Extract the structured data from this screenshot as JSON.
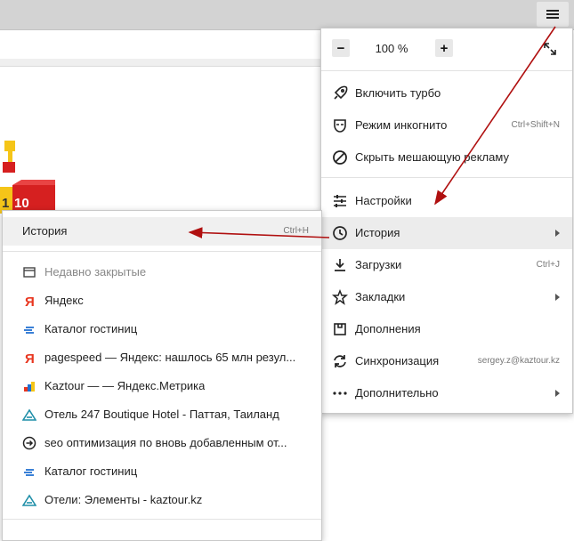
{
  "zoom": {
    "minus": "−",
    "value": "100 %",
    "plus": "+"
  },
  "page": {
    "badge_number": "10",
    "badge_partial": "1"
  },
  "main_menu": {
    "items": [
      {
        "label": "Включить турбо",
        "icon": "rocket-icon"
      },
      {
        "label": "Режим инкогнито",
        "shortcut": "Ctrl+Shift+N",
        "icon": "incognito-mask-icon"
      },
      {
        "label": "Скрыть мешающую рекламу",
        "icon": "block-ads-icon"
      },
      {
        "label": "Настройки",
        "icon": "settings-sliders-icon"
      },
      {
        "label": "История",
        "icon": "history-clock-icon",
        "highlighted": true
      },
      {
        "label": "Загрузки",
        "shortcut": "Ctrl+J",
        "icon": "download-icon"
      },
      {
        "label": "Закладки",
        "icon": "star-icon"
      },
      {
        "label": "Дополнения",
        "icon": "extensions-icon"
      },
      {
        "label": "Синхронизация",
        "shortcut": "sergey.z@kaztour.kz",
        "icon": "sync-icon"
      },
      {
        "label": "Дополнительно",
        "icon": "more-dots-icon"
      }
    ]
  },
  "history_menu": {
    "header": {
      "label": "История",
      "shortcut": "Ctrl+H"
    },
    "recently_closed": "Недавно закрытые",
    "items": [
      {
        "label": "Яндекс",
        "icon": "yandex-icon"
      },
      {
        "label": "Каталог гостиниц",
        "icon": "hotel-catalog-icon"
      },
      {
        "label": "pagespeed — Яндекс: нашлось 65 млн резул...",
        "icon": "yandex-icon"
      },
      {
        "label": "Kaztour — — Яндекс.Метрика",
        "icon": "metrika-icon"
      },
      {
        "label": "Отель 247 Boutique Hotel - Паттая, Таиланд",
        "icon": "kaztour-icon"
      },
      {
        "label": "seo оптимизация по вновь добавленным от...",
        "icon": "arrow-circle-icon"
      },
      {
        "label": "Каталог гостиниц",
        "icon": "hotel-catalog-icon"
      },
      {
        "label": "Отели: Элементы - kaztour.kz",
        "icon": "kaztour-icon"
      }
    ]
  },
  "colors": {
    "annotation_arrow": "#b01010",
    "menu_highlight": "#ececec",
    "toolbar": "#d3d3d3"
  }
}
